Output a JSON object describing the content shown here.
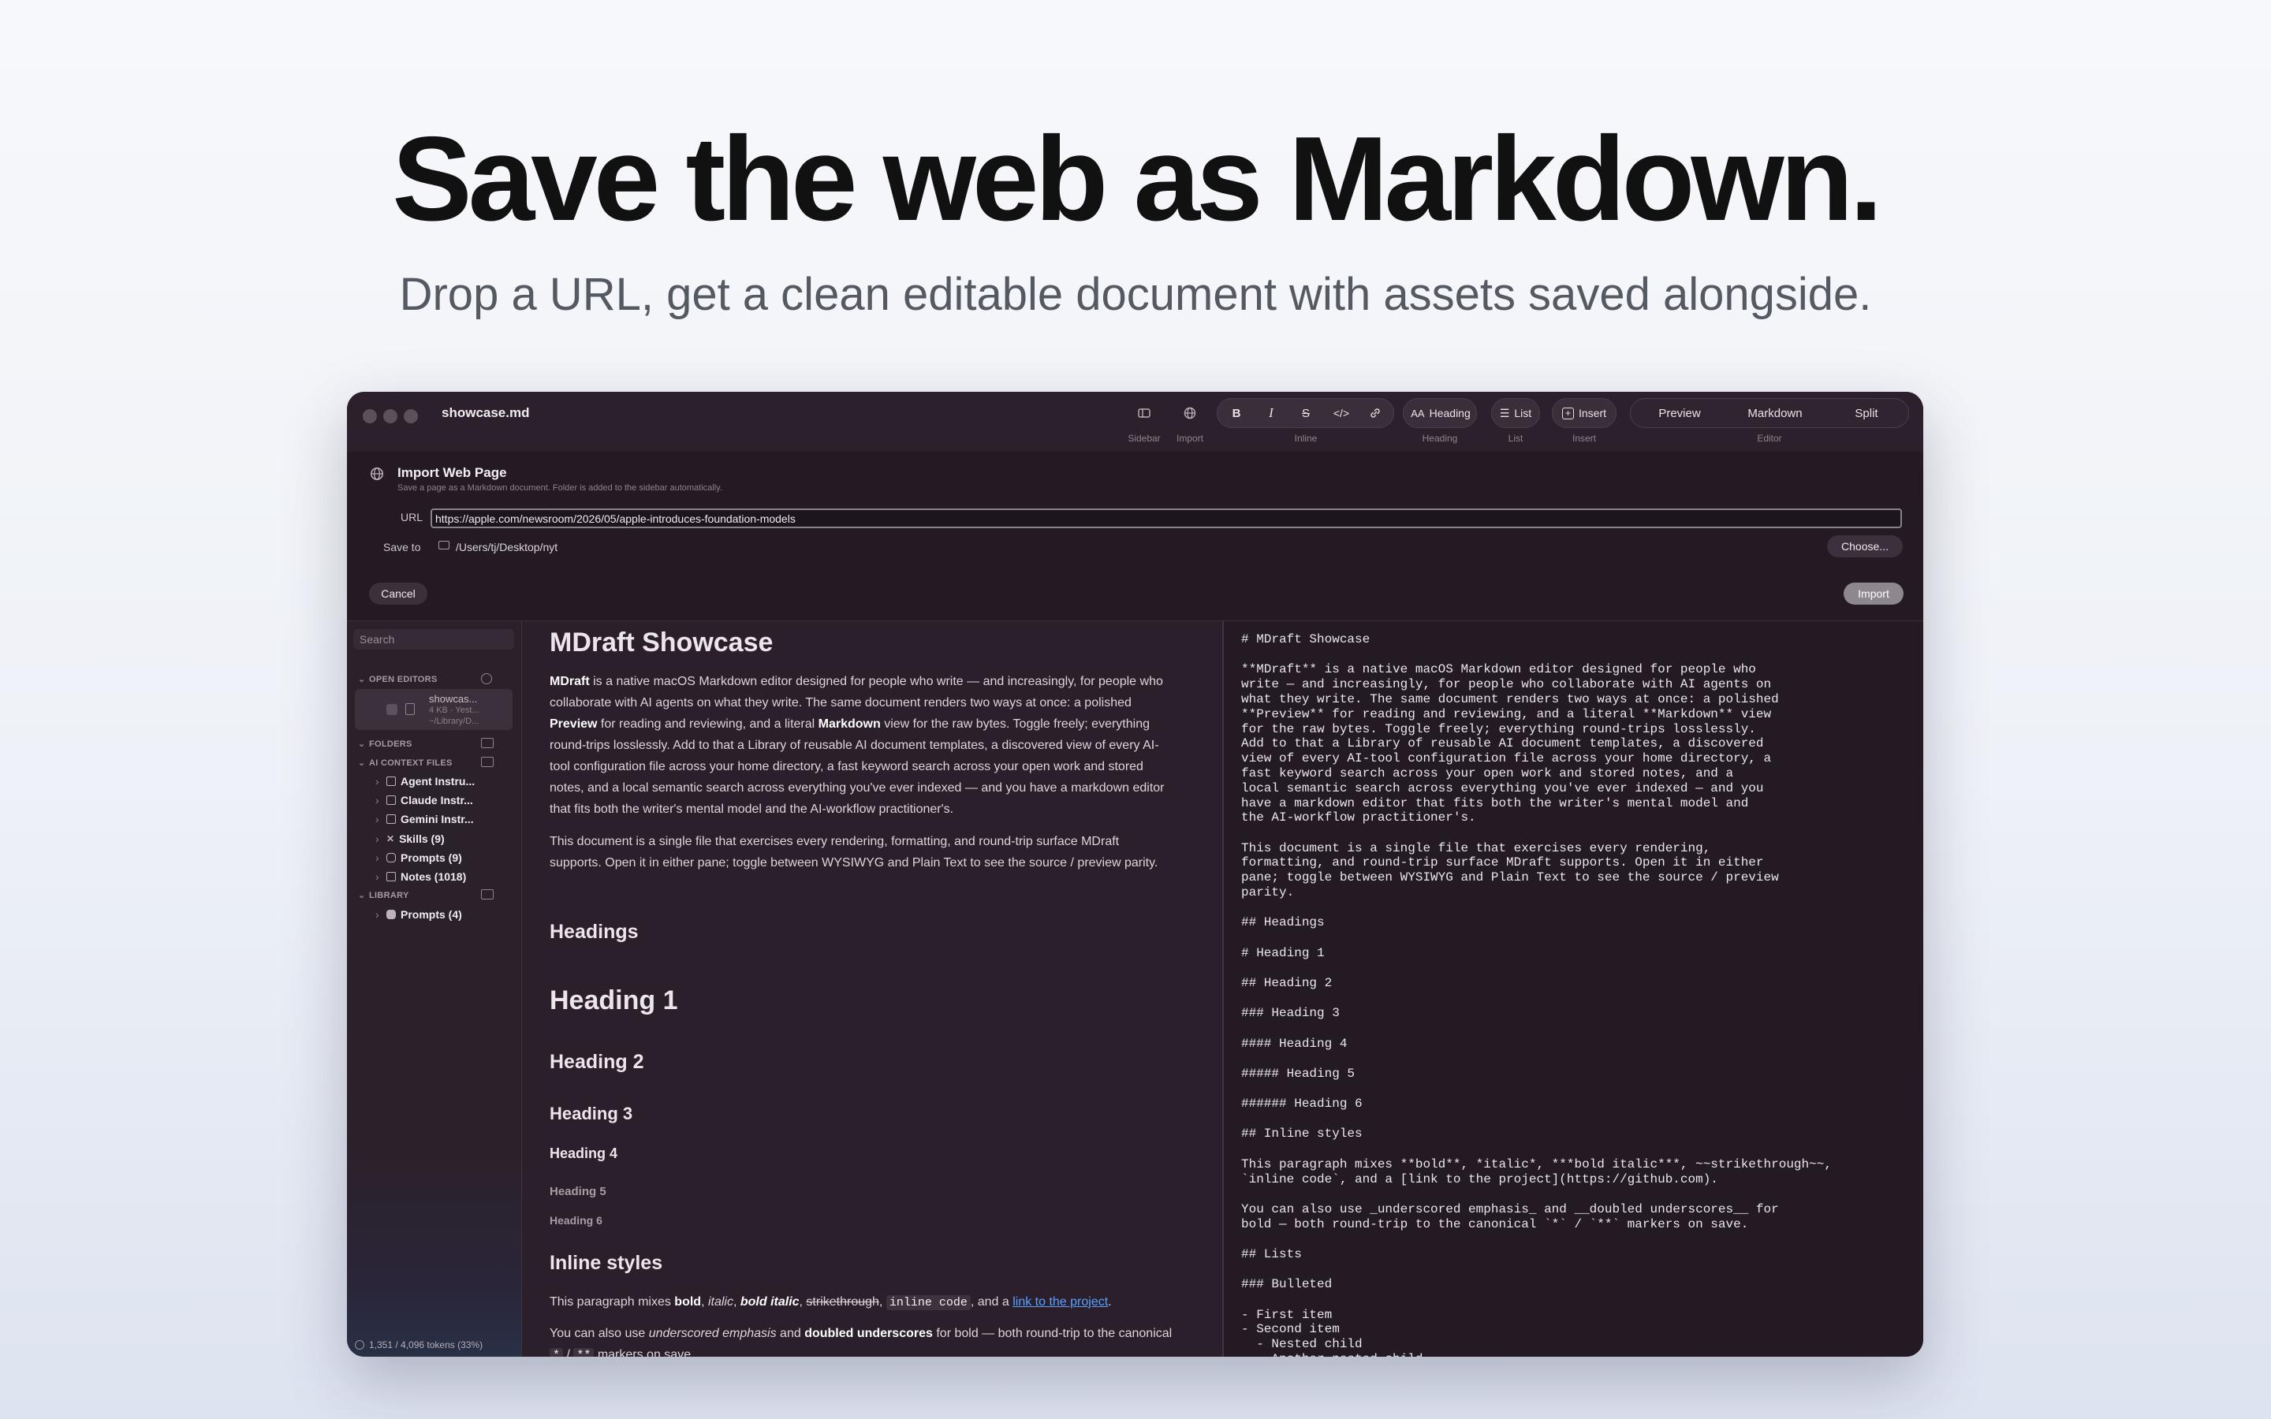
{
  "hero": {
    "title": "Save the web as Markdown.",
    "subtitle": "Drop a URL, get a clean editable document with assets saved alongside."
  },
  "window": {
    "title": "showcase.md",
    "toolbar": {
      "sidebar_caption": "Sidebar",
      "import_caption": "Import",
      "inline_caption": "Inline",
      "bold": "B",
      "italic": "I",
      "strike": "S",
      "code": "</>",
      "heading_label": "Heading",
      "heading_caption": "Heading",
      "list_label": "List",
      "list_caption": "List",
      "insert_label": "Insert",
      "insert_caption": "Insert",
      "mode_preview": "Preview",
      "mode_markdown": "Markdown",
      "mode_split": "Split",
      "editor_caption": "Editor"
    },
    "import_panel": {
      "title": "Import Web Page",
      "description": "Save a page as a Markdown document. Folder is added to the sidebar automatically.",
      "url_label": "URL",
      "url_value": "https://apple.com/newsroom/2026/05/apple-introduces-foundation-models",
      "save_label": "Save to",
      "save_path": "/Users/tj/Desktop/nyt",
      "choose_button": "Choose...",
      "cancel_button": "Cancel",
      "import_button": "Import"
    },
    "sidebar": {
      "search_placeholder": "Search",
      "open_editors_header": "OPEN EDITORS",
      "open_editor": {
        "name": "showcas...",
        "meta": "4 KB · Yest...",
        "path": "~/Library/D..."
      },
      "folders_header": "FOLDERS",
      "ai_context_header": "AI CONTEXT FILES",
      "ai_items": [
        "Agent Instru...",
        "Claude Instr...",
        "Gemini Instr...",
        "Skills (9)",
        "Prompts (9)",
        "Notes (1018)"
      ],
      "library_header": "LIBRARY",
      "library_items": [
        "Prompts (4)"
      ],
      "status": "1,351 / 4,096 tokens (33%)"
    },
    "preview": {
      "h1": "MDraft Showcase",
      "p1_b1": "MDraft",
      "p1_t1": " is a native macOS Markdown editor designed for people who write — and increasingly, for people who collaborate with AI agents on what they write. The same document renders two ways at once: a polished ",
      "p1_b2": "Preview",
      "p1_t2": " for reading and reviewing, and a literal ",
      "p1_b3": "Markdown",
      "p1_t3": " view for the raw bytes. Toggle freely; everything round-trips losslessly. Add to that a Library of reusable AI document templates, a discovered view of every AI-tool configuration file across your home directory, a fast keyword search across your open work and stored notes, and a local semantic search across everything you've ever indexed — and you have a markdown editor that fits both the writer's mental model and the AI-workflow practitioner's.",
      "p2": "This document is a single file that exercises every rendering, formatting, and round-trip surface MDraft supports. Open it in either pane; toggle between WYSIWYG and Plain Text to see the source / preview parity.",
      "headings": "Headings",
      "heading1": "Heading 1",
      "heading2": "Heading 2",
      "heading3": "Heading 3",
      "heading4": "Heading 4",
      "heading5": "Heading 5",
      "heading6": "Heading 6",
      "inline_styles": "Inline styles",
      "p3_t1": "This paragraph mixes ",
      "p3_bold": "bold",
      "p3_italic": "italic",
      "p3_bolditalic": "bold italic",
      "p3_strike": "strikethrough",
      "p3_code": "inline code",
      "p3_t2": ", and a ",
      "p3_link": "link to the project",
      "p4_t1": "You can also use ",
      "p4_em": "underscored emphasis",
      "p4_t2": " and ",
      "p4_b": "doubled underscores",
      "p4_t3": " for bold — both round-trip to the canonical ",
      "p4_t4": "markers on save."
    },
    "source": {
      "lines": [
        "# MDraft Showcase",
        "",
        "**MDraft** is a native macOS Markdown editor designed for people who",
        "write — and increasingly, for people who collaborate with AI agents on",
        "what they write. The same document renders two ways at once: a polished",
        "**Preview** for reading and reviewing, and a literal **Markdown** view",
        "for the raw bytes. Toggle freely; everything round-trips losslessly.",
        "Add to that a Library of reusable AI document templates, a discovered",
        "view of every AI-tool configuration file across your home directory, a",
        "fast keyword search across your open work and stored notes, and a",
        "local semantic search across everything you've ever indexed — and you",
        "have a markdown editor that fits both the writer's mental model and",
        "the AI-workflow practitioner's.",
        "",
        "This document is a single file that exercises every rendering,",
        "formatting, and round-trip surface MDraft supports. Open it in either",
        "pane; toggle between WYSIWYG and Plain Text to see the source / preview",
        "parity.",
        "",
        "## Headings",
        "",
        "# Heading 1",
        "",
        "## Heading 2",
        "",
        "### Heading 3",
        "",
        "#### Heading 4",
        "",
        "##### Heading 5",
        "",
        "###### Heading 6",
        "",
        "## Inline styles",
        "",
        "This paragraph mixes **bold**, *italic*, ***bold italic***, ~~strikethrough~~,",
        "`inline code`, and a [link to the project](https://github.com).",
        "",
        "You can also use _underscored emphasis_ and __doubled underscores__ for",
        "bold — both round-trip to the canonical `*` / `**` markers on save.",
        "",
        "## Lists",
        "",
        "### Bulleted",
        "",
        "- First item",
        "- Second item",
        "  - Nested child",
        "  - Another nested child"
      ]
    }
  }
}
